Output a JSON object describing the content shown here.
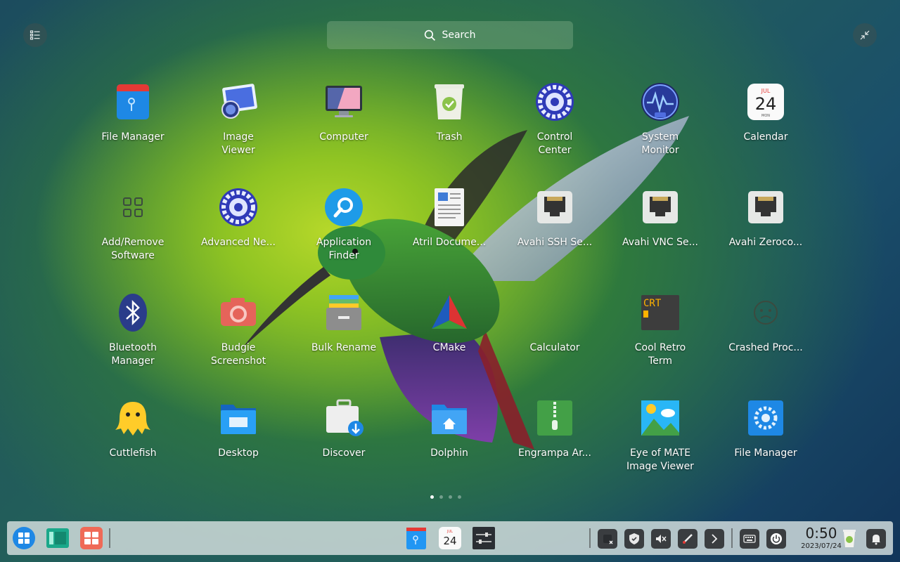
{
  "search": {
    "placeholder": "Search"
  },
  "apps": [
    {
      "label": "File Manager",
      "icon": "file-manager-icon"
    },
    {
      "label": "Image\nViewer",
      "icon": "image-viewer-icon"
    },
    {
      "label": "Computer",
      "icon": "computer-icon"
    },
    {
      "label": "Trash",
      "icon": "trash-icon"
    },
    {
      "label": "Control\nCenter",
      "icon": "control-center-icon"
    },
    {
      "label": "System\nMonitor",
      "icon": "system-monitor-icon"
    },
    {
      "label": "Calendar",
      "icon": "calendar-icon"
    },
    {
      "label": "Add/Remove\nSoftware",
      "icon": "add-remove-software-icon"
    },
    {
      "label": "Advanced Ne...",
      "icon": "advanced-network-icon"
    },
    {
      "label": "Application\nFinder",
      "icon": "application-finder-icon"
    },
    {
      "label": "Atril Docume...",
      "icon": "atril-document-icon"
    },
    {
      "label": "Avahi SSH Se...",
      "icon": "avahi-ssh-icon"
    },
    {
      "label": "Avahi VNC Se...",
      "icon": "avahi-vnc-icon"
    },
    {
      "label": "Avahi Zeroco...",
      "icon": "avahi-zeroconf-icon"
    },
    {
      "label": "Bluetooth\nManager",
      "icon": "bluetooth-icon"
    },
    {
      "label": "Budgie\nScreenshot",
      "icon": "screenshot-camera-icon"
    },
    {
      "label": "Bulk Rename",
      "icon": "bulk-rename-icon"
    },
    {
      "label": "CMake",
      "icon": "cmake-icon"
    },
    {
      "label": "Calculator",
      "icon": "calculator-icon"
    },
    {
      "label": "Cool Retro\nTerm",
      "icon": "cool-retro-term-icon"
    },
    {
      "label": "Crashed Proc...",
      "icon": "crashed-process-icon"
    },
    {
      "label": "Cuttlefish",
      "icon": "cuttlefish-icon"
    },
    {
      "label": "Desktop",
      "icon": "desktop-folder-icon"
    },
    {
      "label": "Discover",
      "icon": "discover-icon"
    },
    {
      "label": "Dolphin",
      "icon": "dolphin-icon"
    },
    {
      "label": "Engrampa Ar...",
      "icon": "engrampa-archive-icon"
    },
    {
      "label": "Eye of MATE\nImage Viewer",
      "icon": "eye-of-mate-icon"
    },
    {
      "label": "File Manager",
      "icon": "file-manager-gear-icon"
    }
  ],
  "calendar_icon": {
    "month": "JUL",
    "day": "24",
    "weekday": "MON"
  },
  "retro_term_text": "CRT",
  "pager": {
    "pages": 4,
    "current": 0
  },
  "taskbar": {
    "clock_time": "0:50",
    "clock_date": "2023/07/24",
    "calendar_day": "24",
    "calendar_month": "JUL"
  },
  "colors": {
    "taskbar_bg": "#d7e1e1",
    "tray_bg": "#3a3d40",
    "accent_blue": "#1e88e5"
  }
}
